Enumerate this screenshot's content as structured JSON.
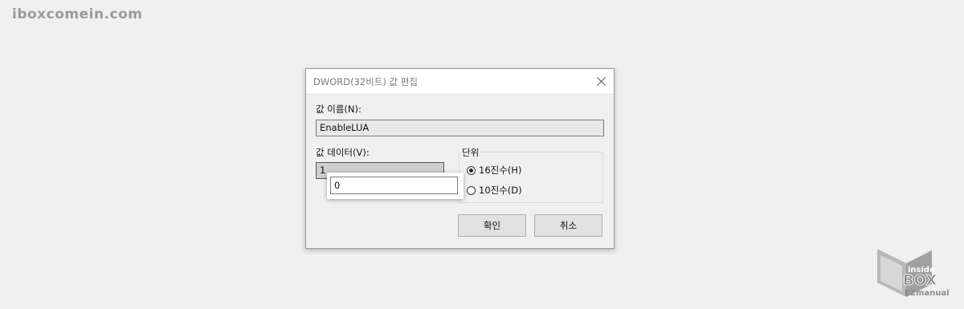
{
  "watermark": "iboxcomein.com",
  "dialog": {
    "title": "DWORD(32비트) 값 편집",
    "name_label": "값 이름(N):",
    "name_value": "EnableLUA",
    "data_label": "값 데이터(V):",
    "data_value": "1",
    "base_group_label": "단위",
    "base_options": [
      {
        "label": "16진수(H)",
        "checked": true
      },
      {
        "label": "10진수(D)",
        "checked": false
      }
    ],
    "ok_label": "확인",
    "cancel_label": "취소"
  },
  "popup": {
    "value": "0"
  },
  "logo": {
    "line1": "inside",
    "line2": "BOX",
    "line3": "EZmanual"
  },
  "colors": {
    "dialog_bg": "#f0f0f0",
    "titlebar_bg": "#ffffff",
    "logo_gray": "#9a9a9a"
  }
}
